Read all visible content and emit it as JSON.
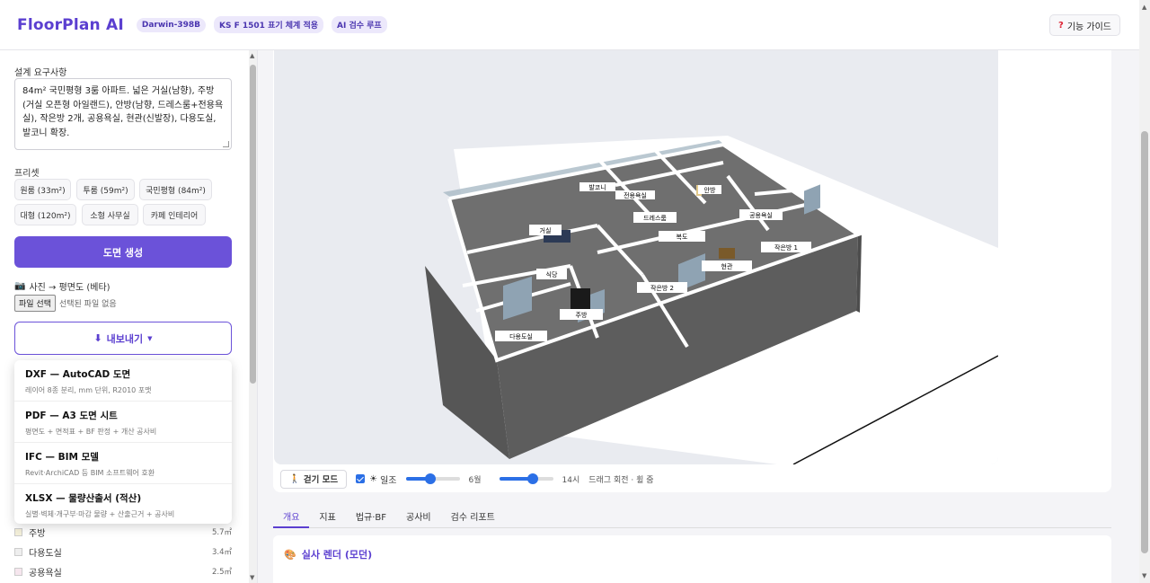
{
  "header": {
    "logo": "FloorPlan AI",
    "badges": [
      "Darwin-398B",
      "KS F 1501 표기 체계 적용",
      "AI 검수 루프"
    ],
    "guide_label": "기능 가이드",
    "guide_icon": "question-icon"
  },
  "sidebar": {
    "requirements_label": "설계 요구사항",
    "requirements_text": "84m² 국민평형 3룸 아파트. 넓은 거실(남향), 주방(거실 오픈형 아일랜드), 안방(남향, 드레스룸+전용욕실), 작은방 2개, 공용욕실, 현관(신발장), 다용도실, 발코니 확장.",
    "preset_label": "프리셋",
    "presets": [
      "원룸 (33m²)",
      "투룸 (59m²)",
      "국민평형 (84m²)",
      "대형 (120m²)",
      "소형 사무실",
      "카페 인테리어"
    ],
    "generate_label": "도면 생성",
    "photo_label": "사진 → 평면도 (베타)",
    "file_button": "파일 선택",
    "file_status": "선택된 파일 없음",
    "export_label": "내보내기",
    "export_options": [
      {
        "title": "DXF — AutoCAD 도면",
        "desc": "레이어 8종 분리, mm 단위, R2010 포맷"
      },
      {
        "title": "PDF — A3 도면 시트",
        "desc": "평면도 + 면적표 + BF 판정 + 개산 공사비"
      },
      {
        "title": "IFC — BIM 모델",
        "desc": "Revit·ArchiCAD 등 BIM 소프트웨어 호환"
      },
      {
        "title": "XLSX — 물량산출서 (적산)",
        "desc": "실별·벽체·개구부·마감 물량 + 산출근거 + 공사비"
      }
    ],
    "rooms": [
      {
        "name": "주방",
        "area": "5.7㎡"
      },
      {
        "name": "다용도실",
        "area": "3.4㎡"
      },
      {
        "name": "공용욕실",
        "area": "2.5㎡"
      }
    ]
  },
  "viewer": {
    "room_labels": [
      "거실",
      "식당",
      "주방",
      "다용도실",
      "작은방 2",
      "현관",
      "복도",
      "작은방 1",
      "공용욕실",
      "드레스룸",
      "전용욕실",
      "안방",
      "발코니"
    ],
    "walk_label": "걷기 모드",
    "sun_label": "일조",
    "month_text": "6월",
    "hour_text": "14시",
    "hint": "드래그 회전 · 휠 줌",
    "month_fraction": 0.45,
    "hour_fraction": 0.65
  },
  "tabs": [
    "개요",
    "지표",
    "법규·BF",
    "공사비",
    "검수 리포트"
  ],
  "render": {
    "title": "실사 렌더 (모던)"
  },
  "colors": {
    "accent": "#6b52d9",
    "floor": "#707070",
    "wall": "#5a5a5a"
  }
}
